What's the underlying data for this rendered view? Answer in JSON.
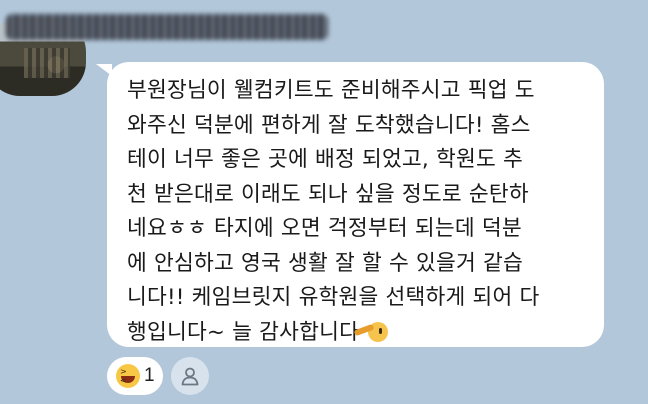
{
  "sender": {
    "name": ""
  },
  "message": {
    "text": "부원장님이 웰컴키트도 준비해주시고 픽업 도\n와주신 덕분에 편하게 잘 도착했습니다! 홈스\n테이 너무 좋은 곳에 배정 되었고, 학원도 추\n천 받은대로 이래도 되나 싶을 정도로 순탄하\n네요ㅎㅎ 타지에 오면 걱정부터 되는데 덕분\n에 안심하고 영국 생활 잘 할 수 있을거 같습\n니다!! 케임브릿지 유학원을 선택하게 되어 다\n행입니다~ 늘 감사합니다",
    "trailing_emoji": "smirk-emoji"
  },
  "reactions": {
    "laugh": {
      "icon": "laughing-face-emoji",
      "count": "1"
    },
    "add": {
      "icon": "person-icon"
    }
  },
  "colors": {
    "background": "#b2c7da",
    "bubble": "#ffffff",
    "text": "#1a1a1a"
  }
}
